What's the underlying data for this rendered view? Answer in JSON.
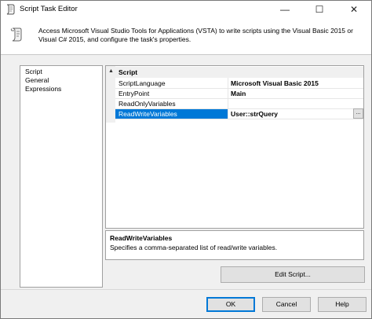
{
  "window": {
    "title": "Script Task Editor",
    "minimize_glyph": "—",
    "maximize_glyph": "☐",
    "close_glyph": "✕"
  },
  "banner": {
    "description": "Access Microsoft Visual Studio Tools for Applications (VSTA) to write scripts using the Visual Basic 2015 or Visual C# 2015, and configure the task's properties.",
    "icon": "script-icon"
  },
  "nav": {
    "items": [
      {
        "label": "Script"
      },
      {
        "label": "General"
      },
      {
        "label": "Expressions"
      }
    ]
  },
  "grid": {
    "category": "Script",
    "collapse_glyph": "▲",
    "properties": [
      {
        "name": "ScriptLanguage",
        "value": "Microsoft Visual Basic 2015"
      },
      {
        "name": "EntryPoint",
        "value": "Main"
      },
      {
        "name": "ReadOnlyVariables",
        "value": ""
      },
      {
        "name": "ReadWriteVariables",
        "value": "User::strQuery"
      }
    ],
    "ellipsis_label": "..."
  },
  "description_panel": {
    "title": "ReadWriteVariables",
    "text": "Specifies a comma-separated list of read/write variables."
  },
  "buttons": {
    "edit_script": "Edit Script...",
    "ok": "OK",
    "cancel": "Cancel",
    "help": "Help"
  },
  "colors": {
    "selection": "#0078d7",
    "dialog_bg": "#f0f0f0"
  }
}
